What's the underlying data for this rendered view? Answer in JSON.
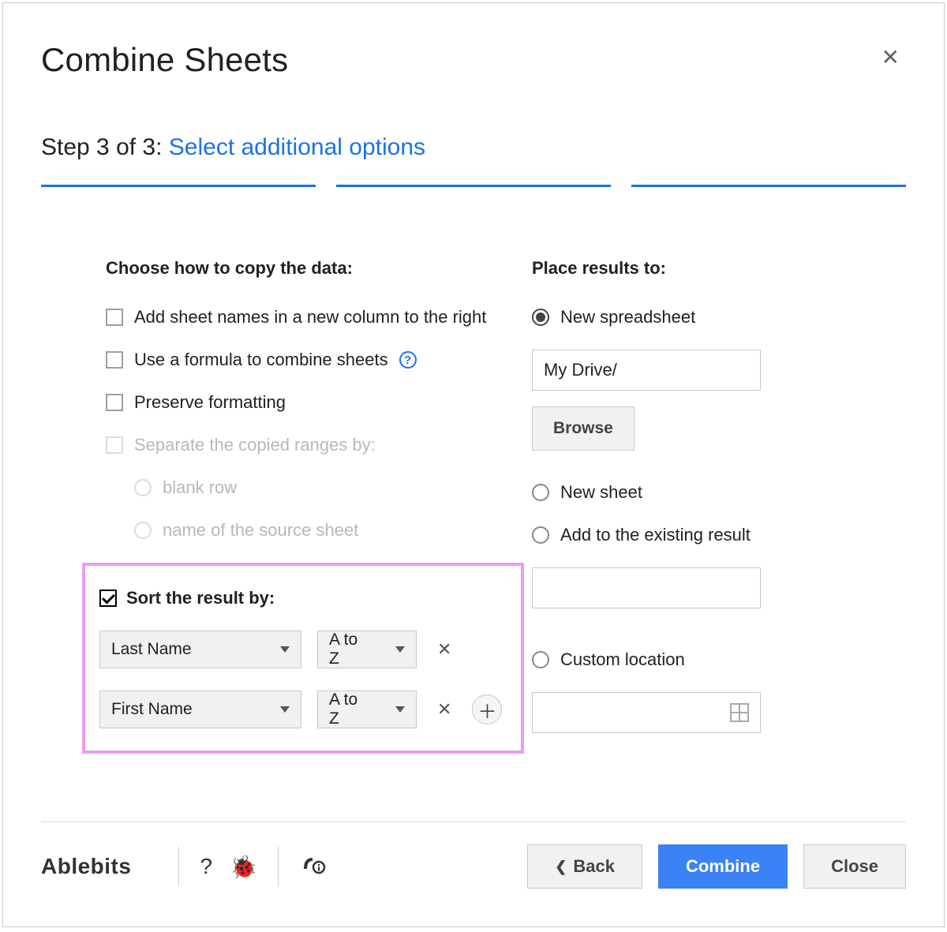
{
  "title": "Combine Sheets",
  "step_prefix": "Step 3 of 3: ",
  "step_link": "Select additional options",
  "left": {
    "heading": "Choose how to copy the data:",
    "opt_add_sheet_names": "Add sheet names in a new column to the right",
    "opt_use_formula": "Use a formula to combine sheets",
    "opt_preserve_formatting": "Preserve formatting",
    "opt_separate": "Separate the copied ranges by:",
    "sub_blank_row": "blank row",
    "sub_name_source": "name of the source sheet",
    "sort_heading": "Sort the result by:",
    "sort_rows": [
      {
        "column": "Last Name",
        "order": "A to Z"
      },
      {
        "column": "First Name",
        "order": "A to Z"
      }
    ]
  },
  "right": {
    "heading": "Place results to:",
    "opt_new_spreadsheet": "New spreadsheet",
    "path_value": "My Drive/",
    "browse": "Browse",
    "opt_new_sheet": "New sheet",
    "opt_add_existing": "Add to the existing result",
    "opt_custom_location": "Custom location"
  },
  "footer": {
    "brand": "Ablebits",
    "help_q": "?",
    "back": "Back",
    "combine": "Combine",
    "close": "Close"
  }
}
